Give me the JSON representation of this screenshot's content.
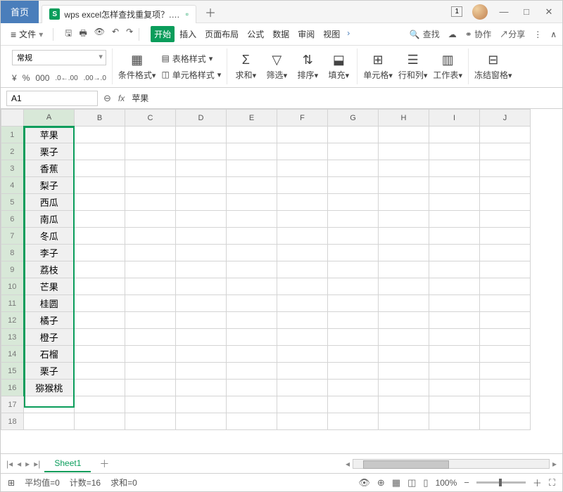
{
  "titlebar": {
    "home": "首页",
    "filename": "wps excel怎样查找重复项？.xlsx",
    "badge": "1"
  },
  "menubar": {
    "file": "文件",
    "tabs": [
      "开始",
      "插入",
      "页面布局",
      "公式",
      "数据",
      "审阅",
      "视图"
    ],
    "search": "查找",
    "coop": "协作",
    "share": "分享"
  },
  "ribbon": {
    "format_sel": "常规",
    "cur": "¥",
    "pct": "%",
    "comma": "000",
    "dec_inc": ".0←.00",
    "dec_dec": ".00→.0",
    "cond": "条件格式",
    "tblstyle": "表格样式",
    "cellstyle": "单元格样式",
    "sum": "求和",
    "filter": "筛选",
    "sort": "排序",
    "fill": "填充",
    "cell": "单元格",
    "rowcol": "行和列",
    "sheet": "工作表",
    "freeze": "冻结窗格"
  },
  "namebar": {
    "ref": "A1",
    "fx": "苹果"
  },
  "columns": [
    "A",
    "B",
    "C",
    "D",
    "E",
    "F",
    "G",
    "H",
    "I",
    "J"
  ],
  "rows": [
    1,
    2,
    3,
    4,
    5,
    6,
    7,
    8,
    9,
    10,
    11,
    12,
    13,
    14,
    15,
    16,
    17,
    18
  ],
  "cells": {
    "A1": "苹果",
    "A2": "栗子",
    "A3": "香蕉",
    "A4": "梨子",
    "A5": "西瓜",
    "A6": "南瓜",
    "A7": "冬瓜",
    "A8": "李子",
    "A9": "荔枝",
    "A10": "芒果",
    "A11": "桂圆",
    "A12": "橘子",
    "A13": "橙子",
    "A14": "石榴",
    "A15": "栗子",
    "A16": "猕猴桃"
  },
  "tabbar": {
    "sheet": "Sheet1"
  },
  "status": {
    "avg": "平均值=0",
    "count": "计数=16",
    "sum": "求和=0",
    "zoom": "100%"
  }
}
